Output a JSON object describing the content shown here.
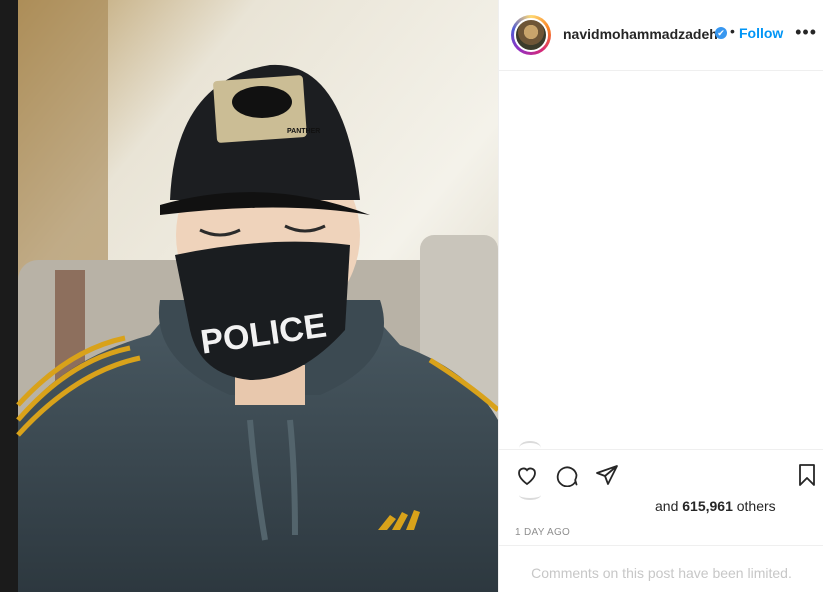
{
  "post": {
    "author": {
      "username": "navidmohammadzadeh",
      "verified_symbol": "✔",
      "separator": "•",
      "follow_label": "Follow",
      "more_label": "•••"
    },
    "photo": {
      "cap_badge_text": "PANTHER",
      "mask_text": "POLICE"
    },
    "likes": {
      "prefix": "and ",
      "count": "615,961",
      "suffix": " others"
    },
    "timestamp": "1 DAY AGO",
    "comments_notice": "Comments on this post have been limited."
  },
  "icons": {
    "like": "heart-icon",
    "comment": "comment-icon",
    "share": "share-icon",
    "save": "bookmark-icon",
    "verified": "verified-badge-icon"
  },
  "colors": {
    "accent": "#0095f6",
    "verified": "#3897f0",
    "muted": "#8e8e8e",
    "border": "#efefef"
  }
}
